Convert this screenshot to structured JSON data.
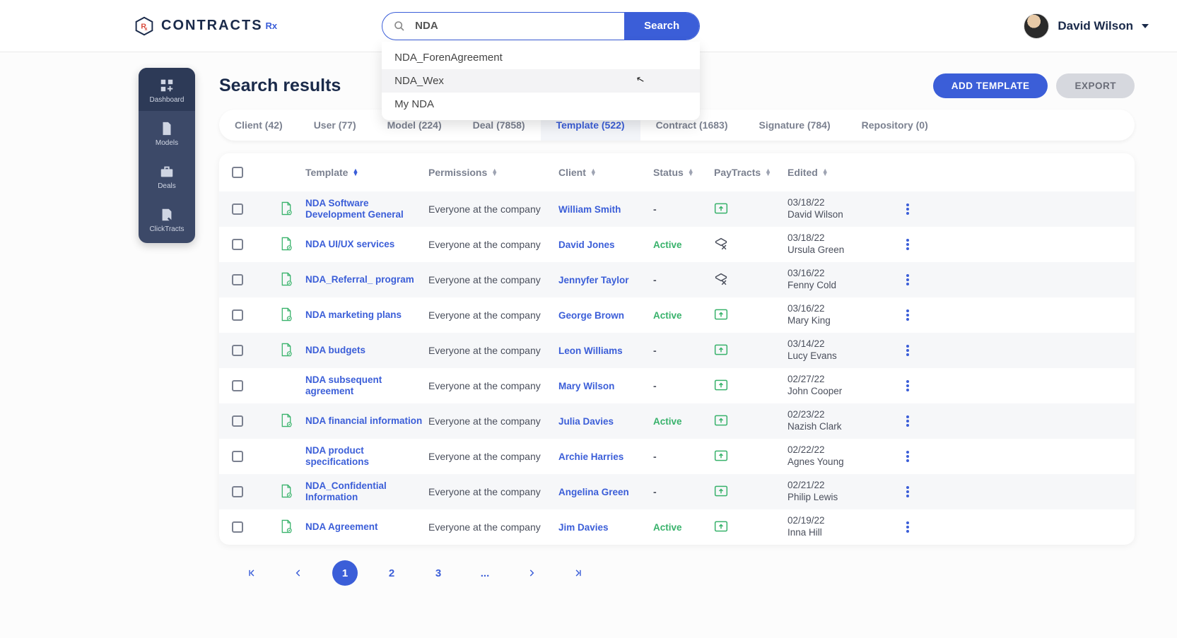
{
  "brand": {
    "name": "CONTRACTS",
    "suffix": "Rx"
  },
  "search": {
    "value": "NDA",
    "button": "Search",
    "suggestions": [
      "NDA_ForenAgreement",
      "NDA_Wex",
      "My NDA"
    ]
  },
  "user": {
    "name": "David Wilson"
  },
  "sidebar": {
    "items": [
      {
        "label": "Dashboard"
      },
      {
        "label": "Models"
      },
      {
        "label": "Deals"
      },
      {
        "label": "ClickTracts"
      }
    ]
  },
  "page": {
    "title": "Search results"
  },
  "buttons": {
    "add_template": "ADD TEMPLATE",
    "export": "EXPORT"
  },
  "tabs": [
    {
      "label": "Client (42)"
    },
    {
      "label": "User (77)"
    },
    {
      "label": "Model (224)"
    },
    {
      "label": "Deal (7858)"
    },
    {
      "label": "Template (522)",
      "active": true
    },
    {
      "label": "Contract (1683)"
    },
    {
      "label": "Signature (784)"
    },
    {
      "label": "Repository (0)"
    }
  ],
  "columns": {
    "template": "Template",
    "permissions": "Permissions",
    "client": "Client",
    "status": "Status",
    "paytracts": "PayTracts",
    "edited": "Edited"
  },
  "rows": [
    {
      "doc": true,
      "template": "NDA Software Development General",
      "permissions": "Everyone at the company",
      "client": "William Smith",
      "status": "-",
      "pay": "up",
      "edited_date": "03/18/22",
      "edited_by": "David Wilson"
    },
    {
      "doc": true,
      "template": "NDA UI/UX services",
      "permissions": "Everyone at the company",
      "client": "David Jones",
      "status": "Active",
      "pay": "edit",
      "edited_date": "03/18/22",
      "edited_by": "Ursula Green"
    },
    {
      "doc": true,
      "template": "NDA_Referral_ program",
      "permissions": "Everyone at the company",
      "client": "Jennyfer Taylor",
      "status": "-",
      "pay": "edit",
      "edited_date": "03/16/22",
      "edited_by": "Fenny Cold"
    },
    {
      "doc": true,
      "template": "NDA marketing plans",
      "permissions": "Everyone at the company",
      "client": "George Brown",
      "status": "Active",
      "pay": "up",
      "edited_date": "03/16/22",
      "edited_by": "Mary King"
    },
    {
      "doc": true,
      "template": "NDA budgets",
      "permissions": "Everyone at the company",
      "client": "Leon Williams",
      "status": "-",
      "pay": "up",
      "edited_date": "03/14/22",
      "edited_by": "Lucy Evans"
    },
    {
      "doc": false,
      "template": "NDA subsequent agreement",
      "permissions": "Everyone at the company",
      "client": "Mary Wilson",
      "status": "-",
      "pay": "up",
      "edited_date": "02/27/22",
      "edited_by": "John Cooper"
    },
    {
      "doc": true,
      "template": "NDA financial information",
      "permissions": "Everyone at the company",
      "client": "Julia Davies",
      "status": "Active",
      "pay": "up",
      "edited_date": "02/23/22",
      "edited_by": "Nazish Clark"
    },
    {
      "doc": false,
      "template": "NDA product specifications",
      "permissions": "Everyone at the company",
      "client": "Archie Harries",
      "status": "-",
      "pay": "up",
      "edited_date": "02/22/22",
      "edited_by": "Agnes Young"
    },
    {
      "doc": true,
      "template": "NDA_Confidential Information",
      "permissions": "Everyone at the company",
      "client": "Angelina Green",
      "status": "-",
      "pay": "up",
      "edited_date": "02/21/22",
      "edited_by": "Philip Lewis"
    },
    {
      "doc": true,
      "template": "NDA Agreement",
      "permissions": "Everyone at the company",
      "client": "Jim Davies",
      "status": "Active",
      "pay": "up",
      "edited_date": "02/19/22",
      "edited_by": "Inna Hill"
    }
  ],
  "pager": {
    "pages": [
      "1",
      "2",
      "3",
      "..."
    ]
  }
}
